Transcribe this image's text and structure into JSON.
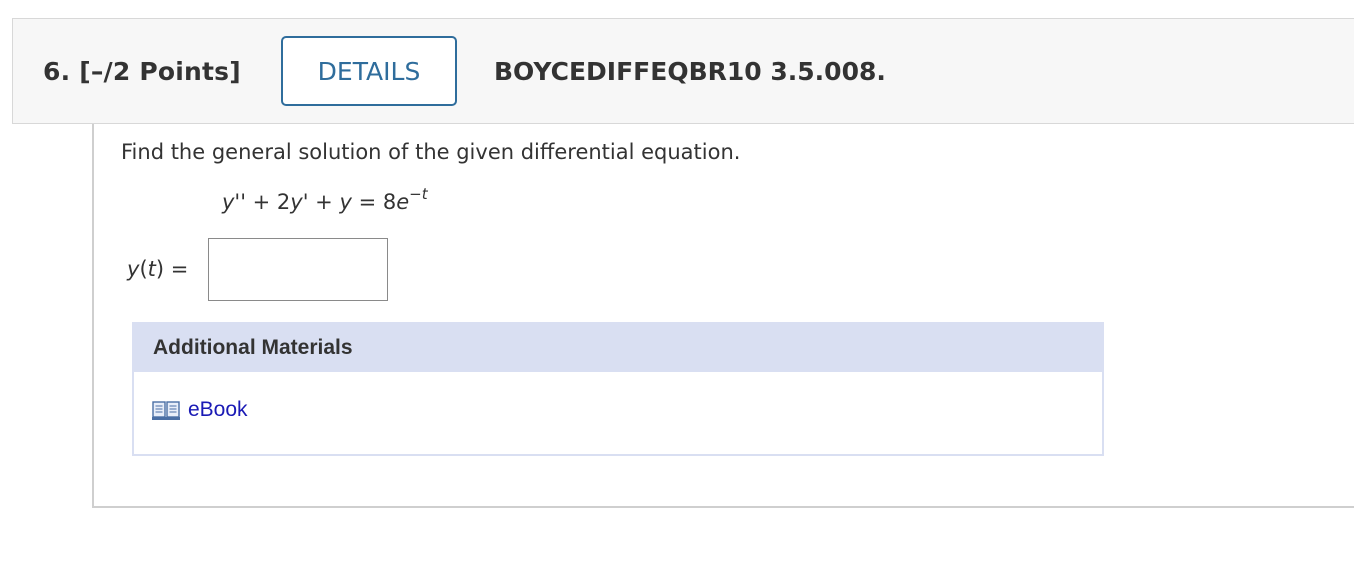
{
  "header": {
    "question_label": "6. [–/2 Points]",
    "details_button": "DETAILS",
    "problem_code": "BOYCEDIFFEQBR10 3.5.008."
  },
  "question": {
    "prompt": "Find the general solution of the given differential equation.",
    "equation": {
      "lhs_y2": "y''",
      "op1": " + 2",
      "y1": "y'",
      "op2": " + ",
      "y": "y",
      "eq": " = 8",
      "base": "e",
      "minus": "−",
      "exp_var": "t"
    },
    "answer": {
      "label_func": "y",
      "label_open": "(",
      "label_var": "t",
      "label_close": ") =",
      "value": "",
      "placeholder": ""
    }
  },
  "materials": {
    "title": "Additional Materials",
    "links": [
      {
        "label": "eBook",
        "icon": "book-icon"
      }
    ]
  },
  "colors": {
    "accent": "#2f6d9c",
    "materials_header_bg": "#d9dff2",
    "link": "#1a1ab5"
  }
}
